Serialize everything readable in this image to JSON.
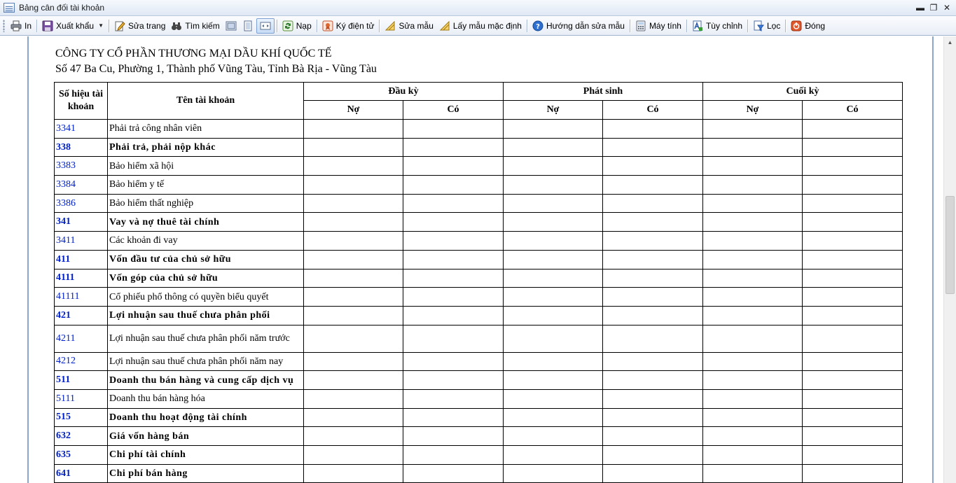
{
  "window": {
    "title": "Bảng cân đối tài khoản",
    "controls": {
      "minimize": "▬",
      "restore": "❐",
      "close": "✕"
    }
  },
  "toolbar": {
    "print": "In",
    "export": "Xuất khẩu",
    "edit_page": "Sửa trang",
    "search": "Tìm kiếm",
    "load": "Nạp",
    "e_sign": "Ký điện tử",
    "edit_template": "Sửa mẫu",
    "default_template": "Lấy mẫu mặc định",
    "template_help": "Hướng dẫn sửa mẫu",
    "calculator": "Máy tính",
    "customize": "Tùy chỉnh",
    "filter": "Lọc",
    "close": "Đóng"
  },
  "report": {
    "company": "CÔNG TY CỔ PHẦN THƯƠNG MẠI DẦU KHÍ QUỐC TẾ",
    "address": "Số 47 Ba Cu, Phường 1, Thành phố Vũng Tàu, Tỉnh Bà Rịa - Vũng Tàu",
    "headers": {
      "account_no": "Số hiệu tài khoản",
      "account_name": "Tên tài khoản",
      "opening": "Đầu kỳ",
      "period": "Phát sinh",
      "closing": "Cuối kỳ",
      "debit": "Nợ",
      "credit": "Có"
    },
    "rows": [
      {
        "code": "3341",
        "name": "Phải trả công nhân viên",
        "bold": false
      },
      {
        "code": "338",
        "name": "Phải trả, phải nộp khác",
        "bold": true
      },
      {
        "code": "3383",
        "name": "Bảo hiểm xã hội",
        "bold": false
      },
      {
        "code": "3384",
        "name": "Bảo hiểm y tế",
        "bold": false
      },
      {
        "code": "3386",
        "name": "Bảo hiểm thất nghiệp",
        "bold": false
      },
      {
        "code": "341",
        "name": "Vay và nợ thuê tài chính",
        "bold": true
      },
      {
        "code": "3411",
        "name": "Các khoản đi vay",
        "bold": false
      },
      {
        "code": "411",
        "name": "Vốn đầu tư của chủ sở hữu",
        "bold": true
      },
      {
        "code": "4111",
        "name": "Vốn góp của chủ sở hữu",
        "bold": true
      },
      {
        "code": "41111",
        "name": "Cổ phiếu phổ thông có quyền biểu quyết",
        "bold": false
      },
      {
        "code": "421",
        "name": "Lợi nhuận sau thuế chưa phân phối",
        "bold": true
      },
      {
        "code": "4211",
        "name": "Lợi nhuận sau thuế chưa phân phối năm trước",
        "bold": false
      },
      {
        "code": "4212",
        "name": "Lợi nhuận sau thuế chưa phân phối năm nay",
        "bold": false
      },
      {
        "code": "511",
        "name": "Doanh thu bán hàng và cung cấp dịch vụ",
        "bold": true
      },
      {
        "code": "5111",
        "name": "Doanh thu bán hàng hóa",
        "bold": false
      },
      {
        "code": "515",
        "name": "Doanh thu hoạt động tài chính",
        "bold": true
      },
      {
        "code": "632",
        "name": "Giá vốn hàng bán",
        "bold": true
      },
      {
        "code": "635",
        "name": "Chi phí tài chính",
        "bold": true
      },
      {
        "code": "641",
        "name": "Chi phí bán hàng",
        "bold": true
      }
    ]
  },
  "colors": {
    "account_code": "#0020c8",
    "page_border": "#8aa6cf"
  },
  "icons": [
    "printer-icon",
    "save-icon",
    "edit-page-icon",
    "binoculars-icon",
    "view-mode-icon",
    "load-icon",
    "sign-icon",
    "pencil-icon",
    "help-icon",
    "calculator-icon",
    "customize-icon",
    "filter-icon",
    "close-icon"
  ]
}
